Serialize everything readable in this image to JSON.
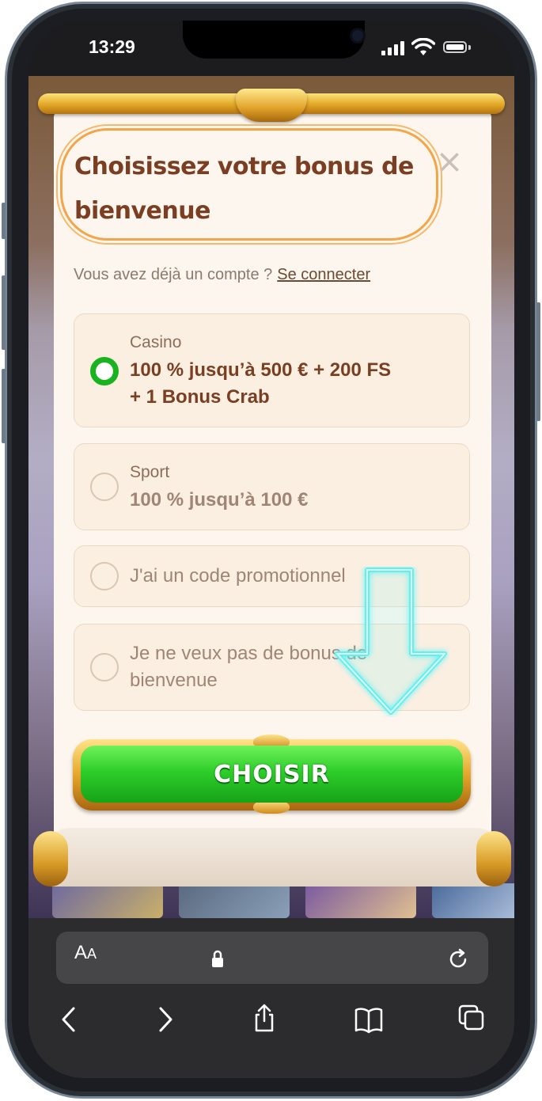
{
  "status_bar": {
    "time": "13:29",
    "icons": [
      "signal-icon",
      "wifi-icon",
      "battery-icon"
    ]
  },
  "modal": {
    "title": "Choisissez votre bonus de bienvenue",
    "close_icon": "×",
    "account_prompt": "Vous avez déjà un compte ?",
    "login_link": "Se connecter",
    "options": [
      {
        "label": "Casino",
        "text": "100 % jusqu’à 500 € + 200 FS\n+ 1 Bonus Crab",
        "selected": true
      },
      {
        "label": "Sport",
        "text": "100 % jusqu’à 100 €",
        "selected": false
      },
      {
        "label": "",
        "text": "J'ai un code promotionnel",
        "selected": false
      },
      {
        "label": "",
        "text": "Je ne veux pas de bonus de\nbienvenue",
        "selected": false
      }
    ],
    "cta_label": "CHOISIR"
  },
  "browser": {
    "aa_label": "A",
    "aa_small": "A",
    "nav": [
      "back-icon",
      "forward-icon",
      "share-icon",
      "bookmarks-icon",
      "tabs-icon"
    ]
  },
  "colors": {
    "title": "#7a3f22",
    "selected_radio": "#18b31e",
    "cta_green": "#2ecd2a",
    "gold": "#e3a726",
    "arrow_cyan": "#5ff0f2"
  }
}
